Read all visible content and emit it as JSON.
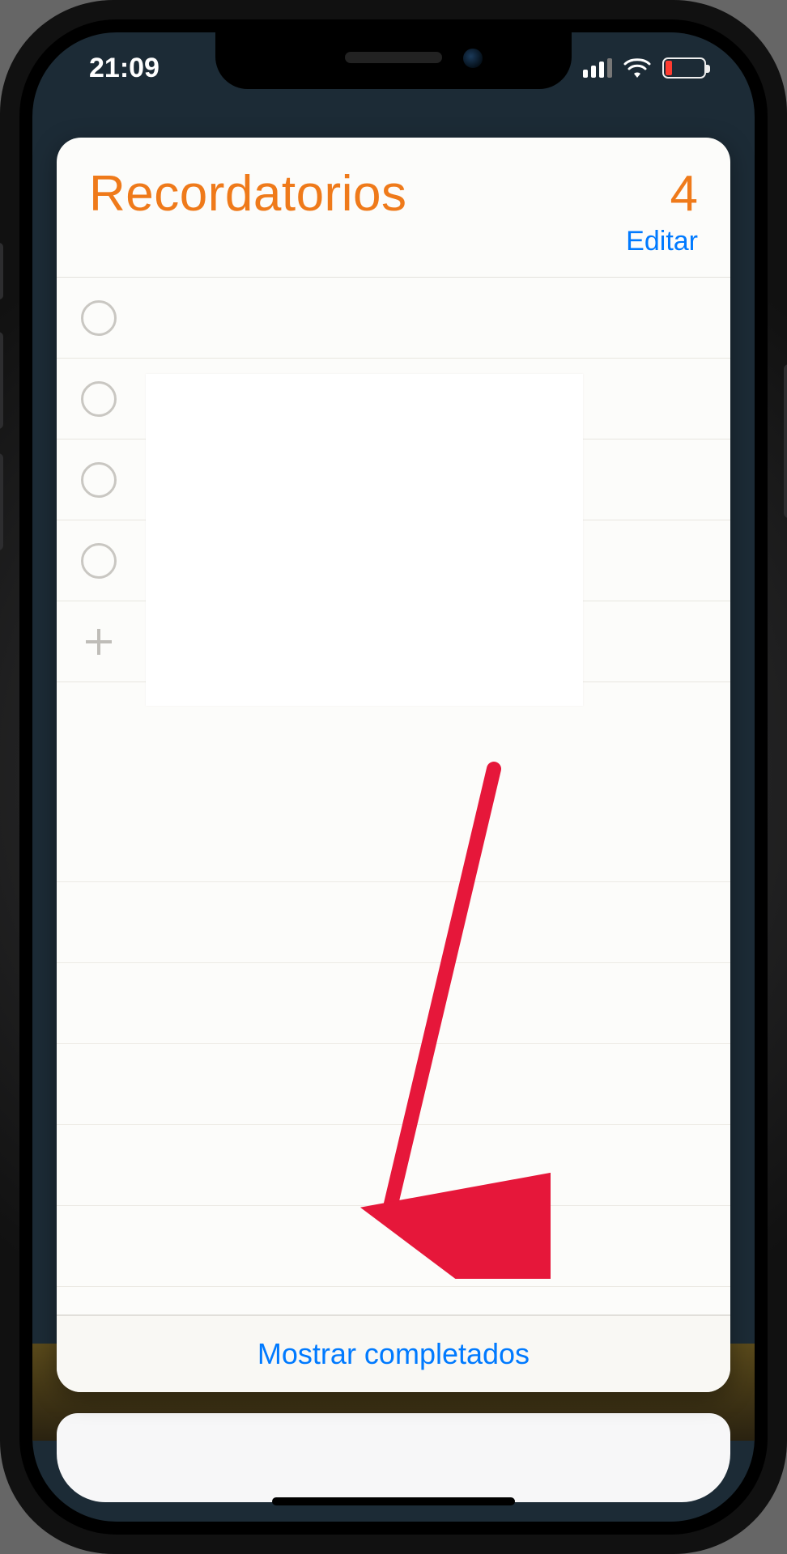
{
  "status": {
    "time": "21:09",
    "signal_bars": 3,
    "wifi": true,
    "battery_low": true
  },
  "card": {
    "title": "Recordatorios",
    "count": "4",
    "edit_label": "Editar",
    "show_completed_label": "Mostrar completados",
    "reminder_rows": 4
  },
  "annotation": {
    "arrow_color": "#e6173a"
  }
}
